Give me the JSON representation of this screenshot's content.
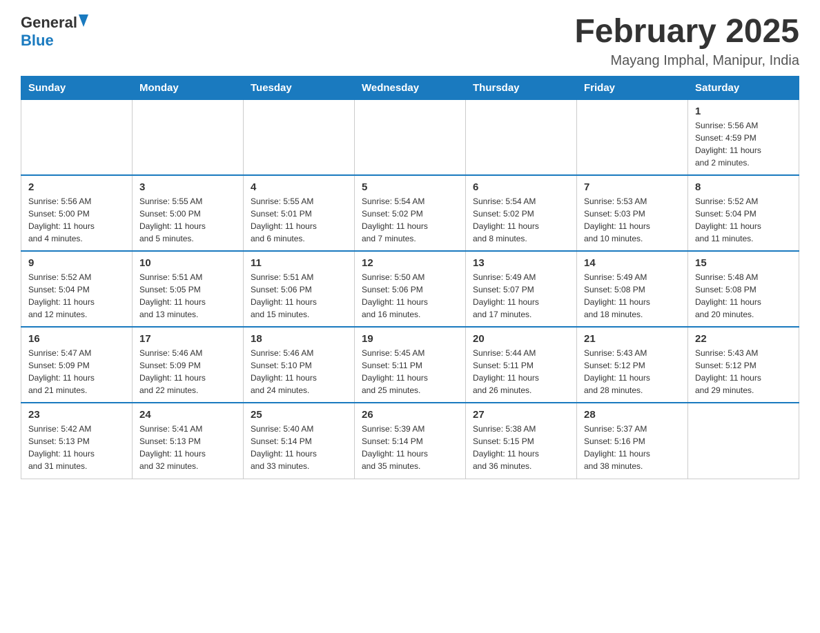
{
  "header": {
    "logo_general": "General",
    "logo_blue": "Blue",
    "month_title": "February 2025",
    "location": "Mayang Imphal, Manipur, India"
  },
  "weekdays": [
    "Sunday",
    "Monday",
    "Tuesday",
    "Wednesday",
    "Thursday",
    "Friday",
    "Saturday"
  ],
  "weeks": [
    [
      {
        "day": "",
        "info": ""
      },
      {
        "day": "",
        "info": ""
      },
      {
        "day": "",
        "info": ""
      },
      {
        "day": "",
        "info": ""
      },
      {
        "day": "",
        "info": ""
      },
      {
        "day": "",
        "info": ""
      },
      {
        "day": "1",
        "info": "Sunrise: 5:56 AM\nSunset: 4:59 PM\nDaylight: 11 hours\nand 2 minutes."
      }
    ],
    [
      {
        "day": "2",
        "info": "Sunrise: 5:56 AM\nSunset: 5:00 PM\nDaylight: 11 hours\nand 4 minutes."
      },
      {
        "day": "3",
        "info": "Sunrise: 5:55 AM\nSunset: 5:00 PM\nDaylight: 11 hours\nand 5 minutes."
      },
      {
        "day": "4",
        "info": "Sunrise: 5:55 AM\nSunset: 5:01 PM\nDaylight: 11 hours\nand 6 minutes."
      },
      {
        "day": "5",
        "info": "Sunrise: 5:54 AM\nSunset: 5:02 PM\nDaylight: 11 hours\nand 7 minutes."
      },
      {
        "day": "6",
        "info": "Sunrise: 5:54 AM\nSunset: 5:02 PM\nDaylight: 11 hours\nand 8 minutes."
      },
      {
        "day": "7",
        "info": "Sunrise: 5:53 AM\nSunset: 5:03 PM\nDaylight: 11 hours\nand 10 minutes."
      },
      {
        "day": "8",
        "info": "Sunrise: 5:52 AM\nSunset: 5:04 PM\nDaylight: 11 hours\nand 11 minutes."
      }
    ],
    [
      {
        "day": "9",
        "info": "Sunrise: 5:52 AM\nSunset: 5:04 PM\nDaylight: 11 hours\nand 12 minutes."
      },
      {
        "day": "10",
        "info": "Sunrise: 5:51 AM\nSunset: 5:05 PM\nDaylight: 11 hours\nand 13 minutes."
      },
      {
        "day": "11",
        "info": "Sunrise: 5:51 AM\nSunset: 5:06 PM\nDaylight: 11 hours\nand 15 minutes."
      },
      {
        "day": "12",
        "info": "Sunrise: 5:50 AM\nSunset: 5:06 PM\nDaylight: 11 hours\nand 16 minutes."
      },
      {
        "day": "13",
        "info": "Sunrise: 5:49 AM\nSunset: 5:07 PM\nDaylight: 11 hours\nand 17 minutes."
      },
      {
        "day": "14",
        "info": "Sunrise: 5:49 AM\nSunset: 5:08 PM\nDaylight: 11 hours\nand 18 minutes."
      },
      {
        "day": "15",
        "info": "Sunrise: 5:48 AM\nSunset: 5:08 PM\nDaylight: 11 hours\nand 20 minutes."
      }
    ],
    [
      {
        "day": "16",
        "info": "Sunrise: 5:47 AM\nSunset: 5:09 PM\nDaylight: 11 hours\nand 21 minutes."
      },
      {
        "day": "17",
        "info": "Sunrise: 5:46 AM\nSunset: 5:09 PM\nDaylight: 11 hours\nand 22 minutes."
      },
      {
        "day": "18",
        "info": "Sunrise: 5:46 AM\nSunset: 5:10 PM\nDaylight: 11 hours\nand 24 minutes."
      },
      {
        "day": "19",
        "info": "Sunrise: 5:45 AM\nSunset: 5:11 PM\nDaylight: 11 hours\nand 25 minutes."
      },
      {
        "day": "20",
        "info": "Sunrise: 5:44 AM\nSunset: 5:11 PM\nDaylight: 11 hours\nand 26 minutes."
      },
      {
        "day": "21",
        "info": "Sunrise: 5:43 AM\nSunset: 5:12 PM\nDaylight: 11 hours\nand 28 minutes."
      },
      {
        "day": "22",
        "info": "Sunrise: 5:43 AM\nSunset: 5:12 PM\nDaylight: 11 hours\nand 29 minutes."
      }
    ],
    [
      {
        "day": "23",
        "info": "Sunrise: 5:42 AM\nSunset: 5:13 PM\nDaylight: 11 hours\nand 31 minutes."
      },
      {
        "day": "24",
        "info": "Sunrise: 5:41 AM\nSunset: 5:13 PM\nDaylight: 11 hours\nand 32 minutes."
      },
      {
        "day": "25",
        "info": "Sunrise: 5:40 AM\nSunset: 5:14 PM\nDaylight: 11 hours\nand 33 minutes."
      },
      {
        "day": "26",
        "info": "Sunrise: 5:39 AM\nSunset: 5:14 PM\nDaylight: 11 hours\nand 35 minutes."
      },
      {
        "day": "27",
        "info": "Sunrise: 5:38 AM\nSunset: 5:15 PM\nDaylight: 11 hours\nand 36 minutes."
      },
      {
        "day": "28",
        "info": "Sunrise: 5:37 AM\nSunset: 5:16 PM\nDaylight: 11 hours\nand 38 minutes."
      },
      {
        "day": "",
        "info": ""
      }
    ]
  ]
}
